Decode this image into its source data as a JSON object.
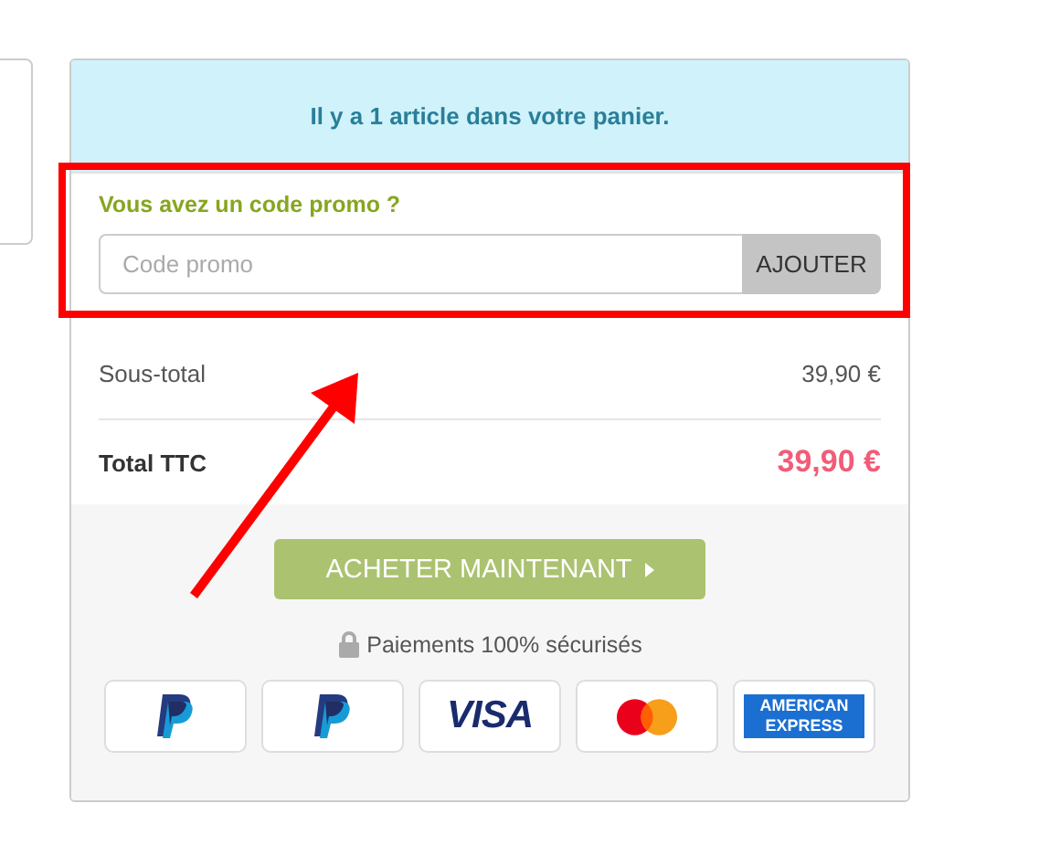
{
  "cart": {
    "summary": "Il y a 1 article dans votre panier.",
    "promo": {
      "title": "Vous avez un code promo ?",
      "placeholder": "Code promo",
      "button": "AJOUTER"
    },
    "lines": [
      {
        "kind": "subtotal",
        "label": "Sous-total",
        "value": "39,90 €"
      },
      {
        "kind": "total",
        "label": "Total TTC",
        "value": "39,90 €"
      }
    ],
    "checkout_button": "ACHETER MAINTENANT",
    "secure_note": "Paiements 100% sécurisés",
    "payment_methods": [
      {
        "kind": "paypal"
      },
      {
        "kind": "paypal"
      },
      {
        "kind": "visa",
        "text": "VISA"
      },
      {
        "kind": "mastercard"
      },
      {
        "kind": "amex",
        "text": "AMERICAN EXPRESS"
      }
    ]
  }
}
